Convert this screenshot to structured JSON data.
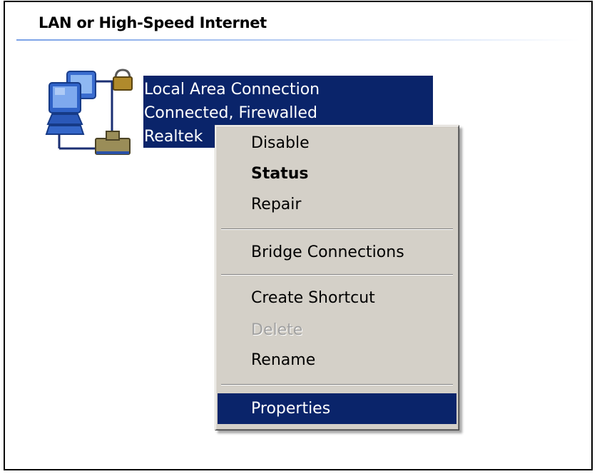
{
  "section": {
    "title": "LAN or High-Speed Internet"
  },
  "connection": {
    "icon": "network-connection-lock-icon",
    "name": "Local Area Connection",
    "status": "Connected, Firewalled",
    "device": "Realtek"
  },
  "context_menu": {
    "disable": "Disable",
    "status": "Status",
    "repair": "Repair",
    "bridge": "Bridge Connections",
    "create_shortcut": "Create Shortcut",
    "delete": "Delete",
    "rename": "Rename",
    "properties": "Properties"
  },
  "colors": {
    "selection": "#0a246a",
    "menu_background": "#d4d0c8",
    "disabled_text": "#a0a0a0"
  }
}
